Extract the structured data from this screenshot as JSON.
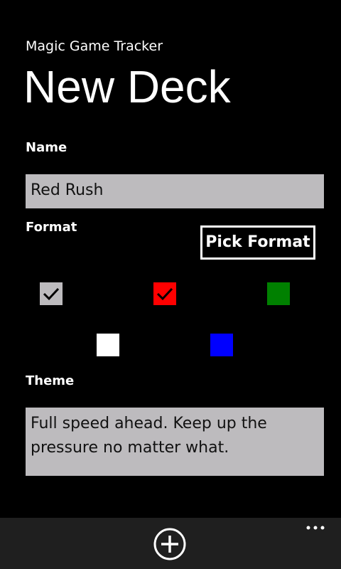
{
  "header": {
    "app_title": "Magic Game Tracker",
    "page_title": "New Deck"
  },
  "form": {
    "name_label": "Name",
    "name_value": "Red Rush",
    "format_label": "Format",
    "pick_format_label": "Pick Format",
    "colors": [
      {
        "name": "gray",
        "color": "#bdbbbe",
        "checked": true
      },
      {
        "name": "red",
        "color": "#ff0000",
        "checked": true
      },
      {
        "name": "green",
        "color": "#008000",
        "checked": false
      },
      {
        "name": "white",
        "color": "#ffffff",
        "checked": false
      },
      {
        "name": "blue",
        "color": "#0000ff",
        "checked": false
      }
    ],
    "theme_label": "Theme",
    "theme_value": "Full speed ahead. Keep up the pressure no matter what."
  },
  "app_bar": {
    "add_icon": "add-icon",
    "more_icon": "more-icon"
  }
}
